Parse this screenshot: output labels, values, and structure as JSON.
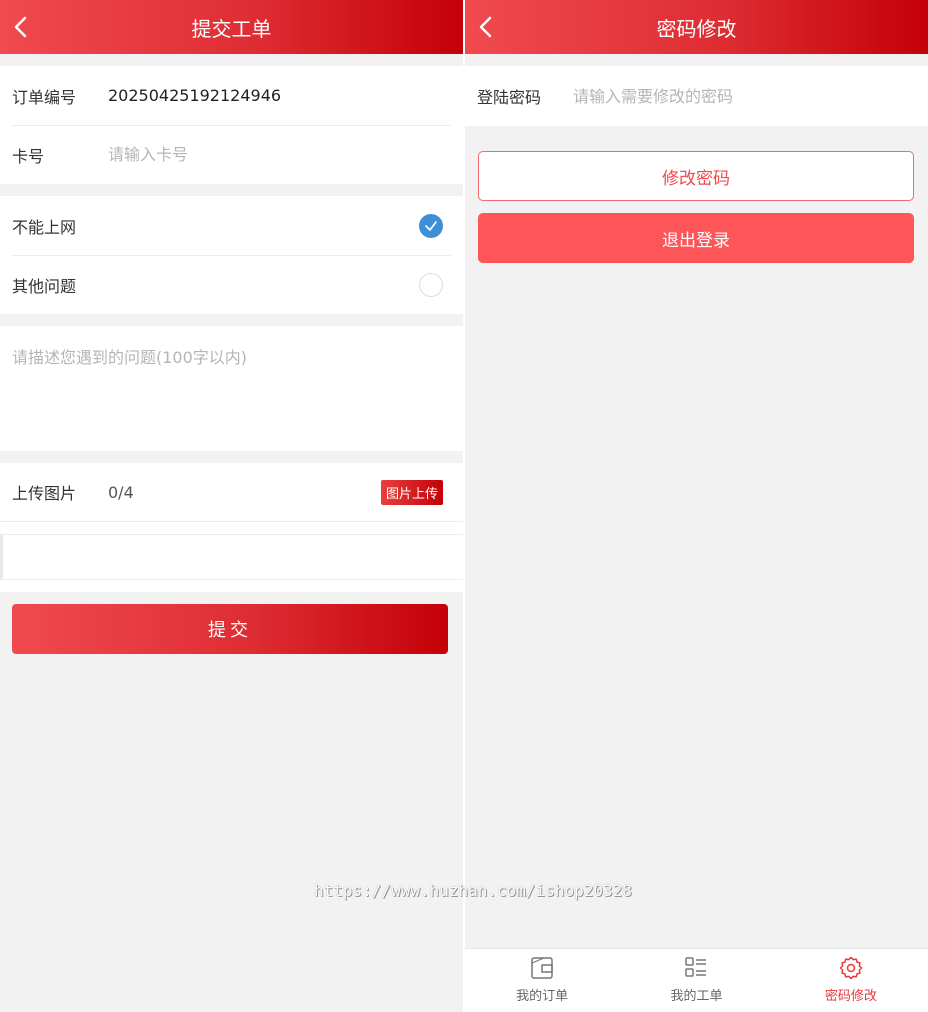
{
  "left": {
    "header": {
      "title": "提交工单"
    },
    "order": {
      "label": "订单编号",
      "value": "20250425192124946"
    },
    "card": {
      "label": "卡号",
      "placeholder": "请输入卡号"
    },
    "problems": [
      {
        "label": "不能上网",
        "checked": true
      },
      {
        "label": "其他问题",
        "checked": false
      }
    ],
    "description": {
      "placeholder": "请描述您遇到的问题(100字以内)"
    },
    "upload": {
      "label": "上传图片",
      "count": "0/4",
      "button": "图片上传"
    },
    "submit": {
      "label": "提交"
    }
  },
  "watermark": "https://www.huzhan.com/ishop20328",
  "right": {
    "header": {
      "title": "密码修改"
    },
    "password": {
      "label": "登陆密码",
      "placeholder": "请输入需要修改的密码"
    },
    "change_button": "修改密码",
    "logout_button": "退出登录",
    "tabs": [
      {
        "label": "我的订单",
        "icon": "wallet-icon",
        "active": false
      },
      {
        "label": "我的工单",
        "icon": "list-icon",
        "active": false
      },
      {
        "label": "密码修改",
        "icon": "gear-icon",
        "active": true
      }
    ]
  },
  "colors": {
    "brand_start": "#f04a4f",
    "brand_end": "#c40008",
    "logout_bg": "#fe5658",
    "check_blue": "#3f8ed8"
  }
}
